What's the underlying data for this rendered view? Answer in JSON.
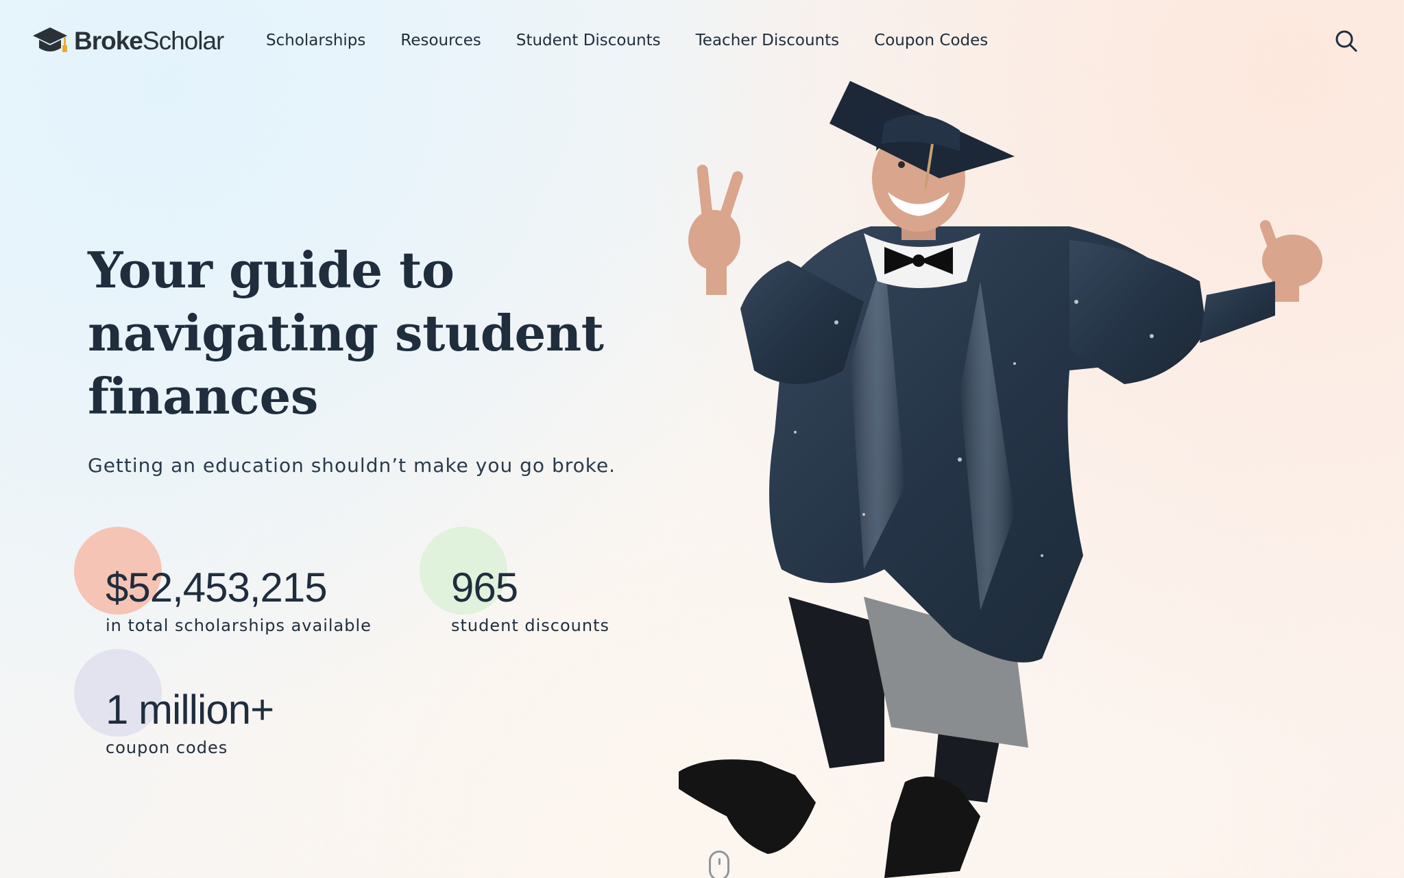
{
  "header": {
    "logo": {
      "brand_bold": "Broke",
      "brand_light": "Scholar",
      "icon": "graduation-cap-icon"
    },
    "nav": [
      {
        "label": "Scholarships"
      },
      {
        "label": "Resources"
      },
      {
        "label": "Student Discounts"
      },
      {
        "label": "Teacher Discounts"
      },
      {
        "label": "Coupon Codes"
      }
    ],
    "search_icon": "search-icon"
  },
  "hero": {
    "headline": "Your guide to navigating student finances",
    "subtitle": "Getting an education shouldn’t make you go broke.",
    "stats": [
      {
        "value": "$52,453,215",
        "label": "in total scholarships available",
        "color": "#f6c4b4"
      },
      {
        "value": "965",
        "label": "student discounts",
        "color": "#e0f1dc"
      },
      {
        "value": "1 million+",
        "label": "coupon codes",
        "color": "#e3e3ef"
      }
    ],
    "image": "jumping-graduate-photo",
    "scroll_icon": "mouse-scroll-icon"
  },
  "colors": {
    "text": "#1f2d3d",
    "gown": "#2a3a4d",
    "background_blue": "#e3f3fc",
    "background_peach": "#fde8dd"
  }
}
